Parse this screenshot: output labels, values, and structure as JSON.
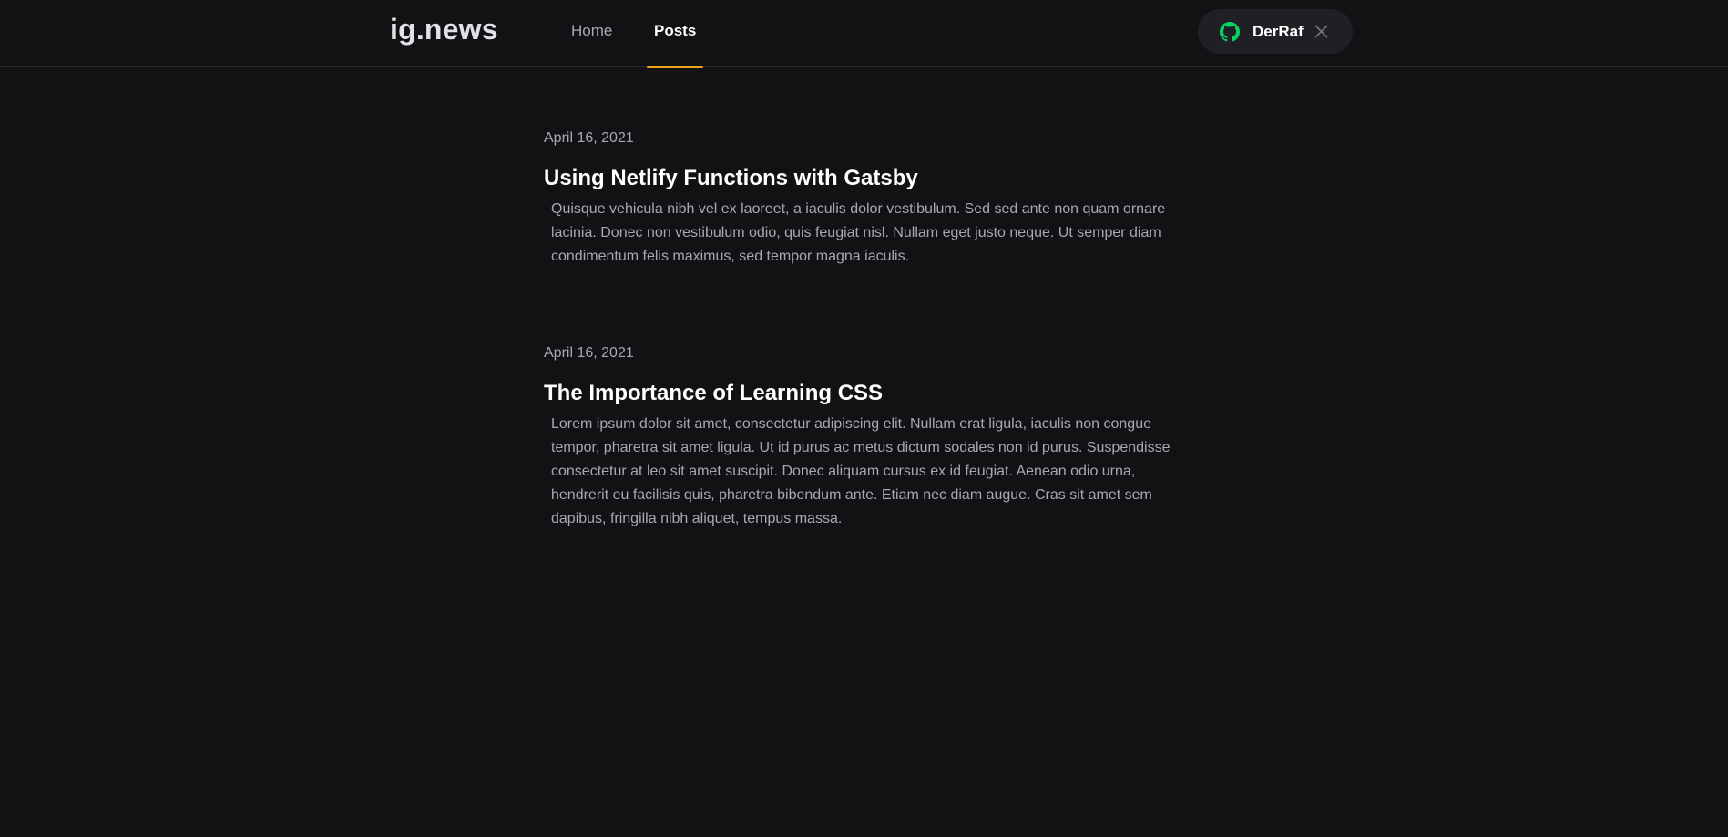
{
  "header": {
    "logo": "ig.news",
    "nav": [
      {
        "label": "Home",
        "active": false
      },
      {
        "label": "Posts",
        "active": true
      }
    ],
    "user": {
      "name": "DerRaf",
      "icon": "github-icon",
      "close_icon": "close-icon"
    }
  },
  "posts": [
    {
      "date": "April 16, 2021",
      "title": "Using Netlify Functions with Gatsby",
      "excerpt": "Quisque vehicula nibh vel ex laoreet, a iaculis dolor vestibulum. Sed sed ante non quam ornare lacinia. Donec non vestibulum odio, quis feugiat nisl. Nullam eget justo neque. Ut semper diam condimentum felis maximus, sed tempor magna iaculis."
    },
    {
      "date": "April 16, 2021",
      "title": "The Importance of Learning CSS",
      "excerpt": "Lorem ipsum dolor sit amet, consectetur adipiscing elit. Nullam erat ligula, iaculis non congue tempor, pharetra sit amet ligula. Ut id purus ac metus dictum sodales non id purus. Suspendisse consectetur at leo sit amet suscipit. Donec aliquam cursus ex id feugiat. Aenean odio urna, hendrerit eu facilisis quis, pharetra bibendum ante. Etiam nec diam augue. Cras sit amet sem dapibus, fringilla nibh aliquet, tempus massa."
    }
  ],
  "colors": {
    "background": "#121214",
    "accent": "#eba417",
    "github_green": "#04d361",
    "muted_text": "#a8a8b3",
    "button_background": "#202024"
  }
}
